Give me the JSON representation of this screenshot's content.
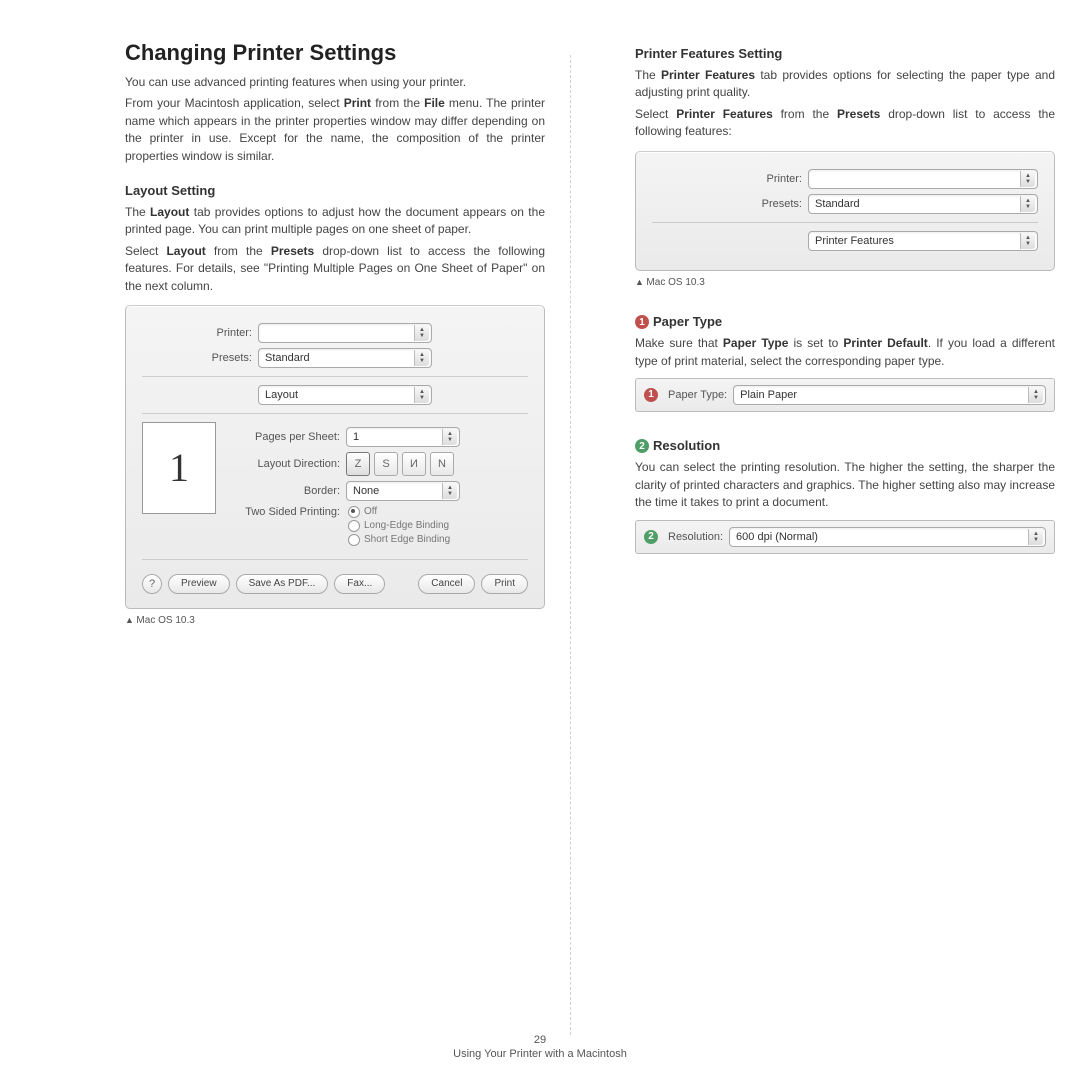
{
  "page": {
    "number": "29",
    "footer": "Using Your Printer with a Macintosh"
  },
  "left": {
    "title": "Changing Printer Settings",
    "intro1": "You can use advanced printing features when using your printer.",
    "intro2a": "From your Macintosh application, select ",
    "intro2b": "Print",
    "intro2c": " from the ",
    "intro2d": "File",
    "intro2e": " menu. The printer name which appears in the printer properties window may differ depending on the printer in use. Except for the name, the composition of the printer properties window is similar.",
    "layout_h": "Layout Setting",
    "layout_p1a": "The ",
    "layout_p1b": "Layout",
    "layout_p1c": " tab provides options to adjust how the document appears on the printed page. You can print multiple pages on one sheet of paper.",
    "layout_p2a": "Select ",
    "layout_p2b": "Layout",
    "layout_p2c": " from the ",
    "layout_p2d": "Presets",
    "layout_p2e": " drop-down list to access the following features. For details, see \"Printing Multiple Pages on One Sheet of Paper\" on the next column.",
    "caption": "Mac OS 10.3",
    "dialog": {
      "printer_label": "Printer:",
      "printer_value": "",
      "presets_label": "Presets:",
      "presets_value": "Standard",
      "section_value": "Layout",
      "pps_label": "Pages per Sheet:",
      "pps_value": "1",
      "dir_label": "Layout Direction:",
      "border_label": "Border:",
      "border_value": "None",
      "two_label": "Two Sided Printing:",
      "radio_off": "Off",
      "radio_long": "Long-Edge Binding",
      "radio_short": "Short Edge Binding",
      "preview_num": "1",
      "btn_help": "?",
      "btn_preview": "Preview",
      "btn_save": "Save As PDF...",
      "btn_fax": "Fax...",
      "btn_cancel": "Cancel",
      "btn_print": "Print"
    }
  },
  "right": {
    "pfs_h": "Printer Features Setting",
    "pfs_p1a": "The ",
    "pfs_p1b": "Printer Features",
    "pfs_p1c": " tab provides options for selecting the paper type and adjusting print quality.",
    "pfs_p2a": "Select ",
    "pfs_p2b": "Printer Features",
    "pfs_p2c": " from the ",
    "pfs_p2d": "Presets",
    "pfs_p2e": " drop-down list to access the following features:",
    "caption": "Mac OS 10.3",
    "dialog": {
      "printer_label": "Printer:",
      "printer_value": "",
      "presets_label": "Presets:",
      "presets_value": "Standard",
      "section_value": "Printer Features"
    },
    "pt_num": "1",
    "pt_h": "Paper Type",
    "pt_p_a": "Make sure that ",
    "pt_p_b": "Paper Type",
    "pt_p_c": " is set to ",
    "pt_p_d": "Printer Default",
    "pt_p_e": ". If you load a different type of print material, select the corresponding paper type.",
    "pt_box": {
      "num": "1",
      "label": "Paper Type:",
      "value": "Plain Paper"
    },
    "res_num": "2",
    "res_h": "Resolution",
    "res_p": "You can select the printing resolution. The higher the setting, the sharper the clarity of printed characters and graphics. The higher setting also may increase the time it takes to print a document.",
    "res_box": {
      "num": "2",
      "label": "Resolution:",
      "value": "600 dpi (Normal)"
    }
  }
}
